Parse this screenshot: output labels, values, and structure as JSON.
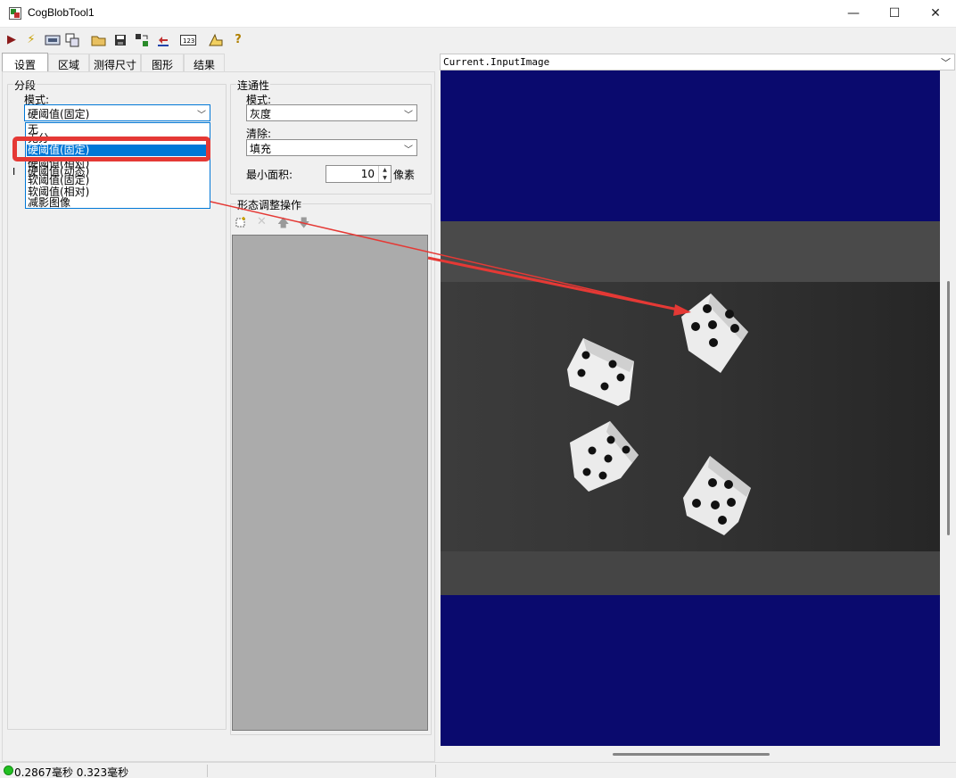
{
  "window": {
    "title": "CogBlobTool1",
    "minimize": "—",
    "maximize": "☐",
    "close": "✕"
  },
  "toolbar": {
    "icons": [
      "run-icon",
      "electric-icon",
      "image-icon",
      "help-view-icon",
      "open-icon",
      "save-icon",
      "reset-icon",
      "load-icon",
      "number-icon",
      "measure-icon",
      "help-icon"
    ]
  },
  "tabs": [
    {
      "label": "设置",
      "active": true
    },
    {
      "label": "区域"
    },
    {
      "label": "测得尺寸"
    },
    {
      "label": "图形"
    },
    {
      "label": "结果"
    }
  ],
  "segmentation": {
    "title": "分段",
    "mode_label": "模式:",
    "mode_value": "硬阈值(固定)",
    "options": [
      "无",
      "硬阈值(固定)",
      "硬阈值(相对)",
      "硬阈值(动态)",
      "软阈值(固定)",
      "软阈值(相对)",
      "减影图像"
    ],
    "obscured_option": "无分"
  },
  "connectivity": {
    "title": "连通性",
    "mode_label": "模式:",
    "mode_value": "灰度",
    "clear_label": "清除:",
    "clear_value": "填充",
    "min_area_label": "最小面积:",
    "min_area_value": "10",
    "min_area_unit": "像素"
  },
  "morphology": {
    "title": "形态调整操作"
  },
  "image_selector": {
    "value": "Current.InputImage"
  },
  "status": {
    "text": "0.2867毫秒 0.323毫秒"
  },
  "colors": {
    "display_bg": "#0a0a6e",
    "selection": "#0078d7",
    "highlight": "#e53935",
    "status_ok": "#22c022"
  }
}
